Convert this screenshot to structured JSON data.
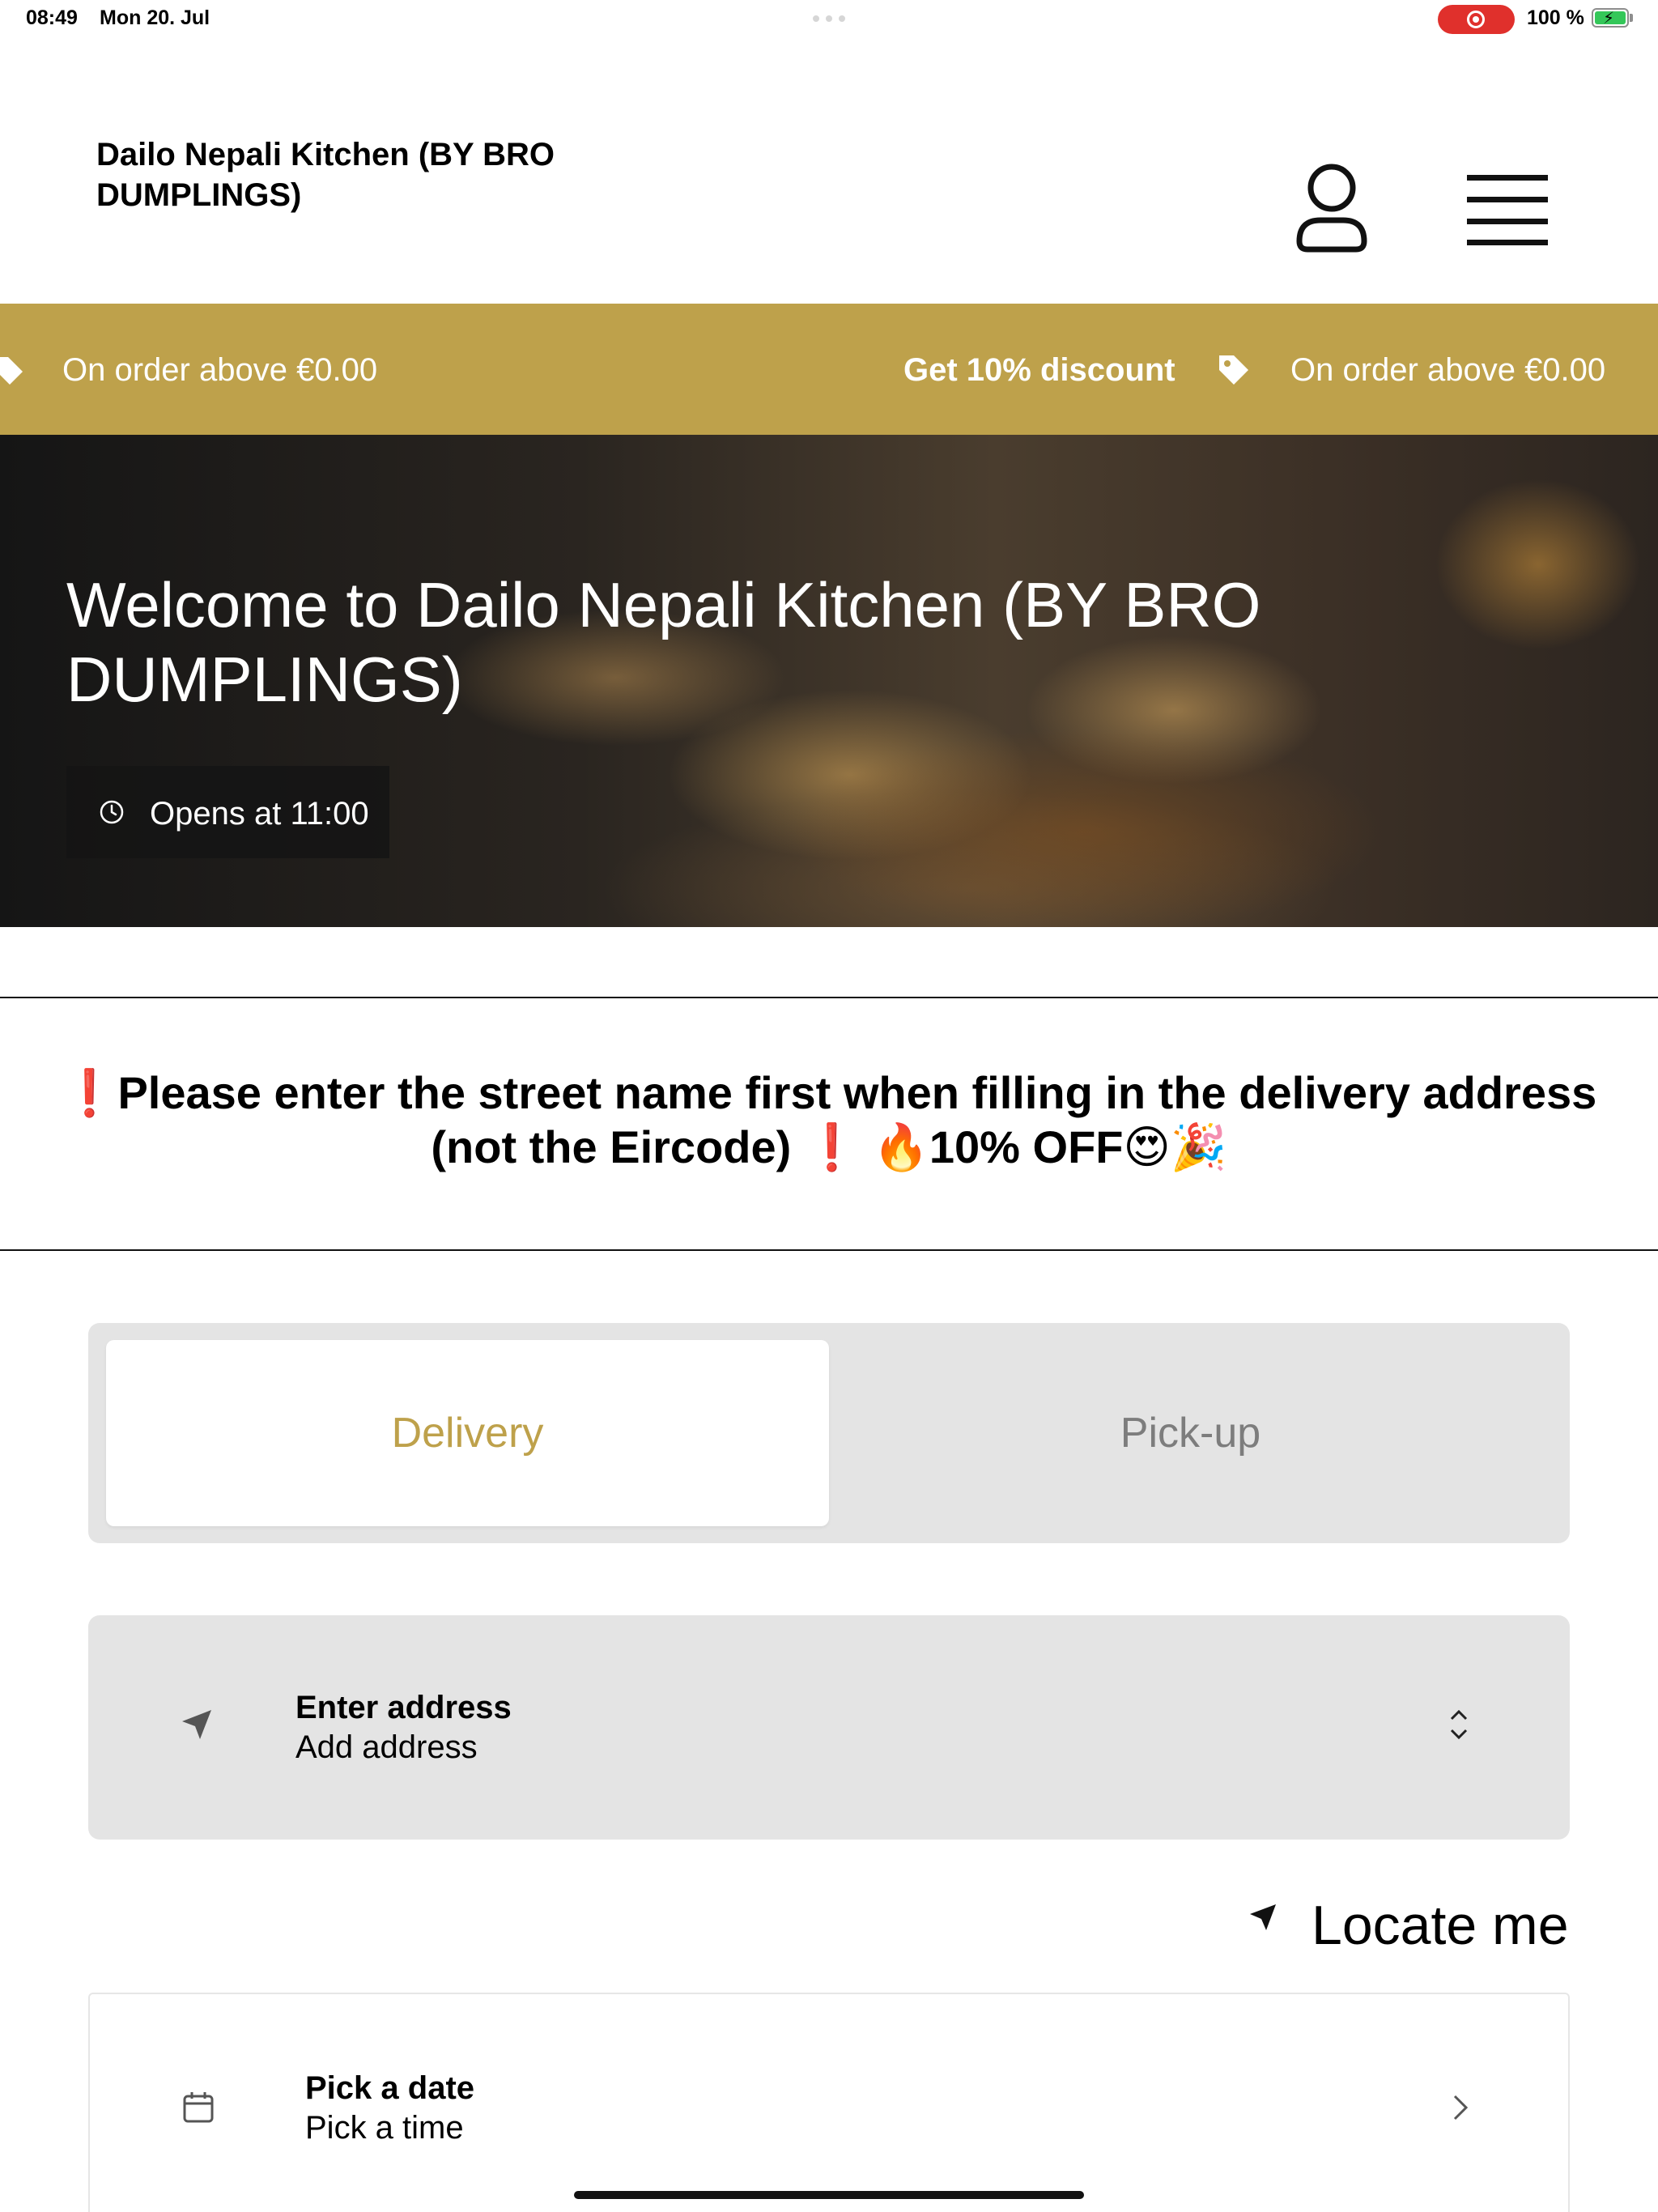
{
  "status_bar": {
    "time": "08:49",
    "date": "Mon 20. Jul",
    "battery": "100 %"
  },
  "header": {
    "brand": "Dailo Nepali Kitchen (BY BRO DUMPLINGS)"
  },
  "promo": {
    "text_left": "On order above €0.00",
    "discount": "Get 10% discount",
    "text_right": "On order above €0.00",
    "background": "#bea14b"
  },
  "hero": {
    "title": "Welcome to Dailo Nepali Kitchen (BY BRO DUMPLINGS)",
    "opens": "Opens at 11:00"
  },
  "notice": {
    "mark_1": "❗",
    "text": "Please enter the street name first when filling in the delivery address (not the Eircode)",
    "mark_2": "❗",
    "promo": " 🔥10% OFF😍🎉"
  },
  "order_mode": {
    "delivery": "Delivery",
    "pickup": "Pick-up",
    "selected": "Delivery",
    "accent": "#bea14b"
  },
  "address": {
    "title": "Enter address",
    "value": "Add address",
    "icon": "navigation-arrow-icon"
  },
  "locate": {
    "label": "Locate me"
  },
  "schedule": {
    "date": "Pick a date",
    "time": "Pick a time",
    "icon": "calendar-icon"
  }
}
